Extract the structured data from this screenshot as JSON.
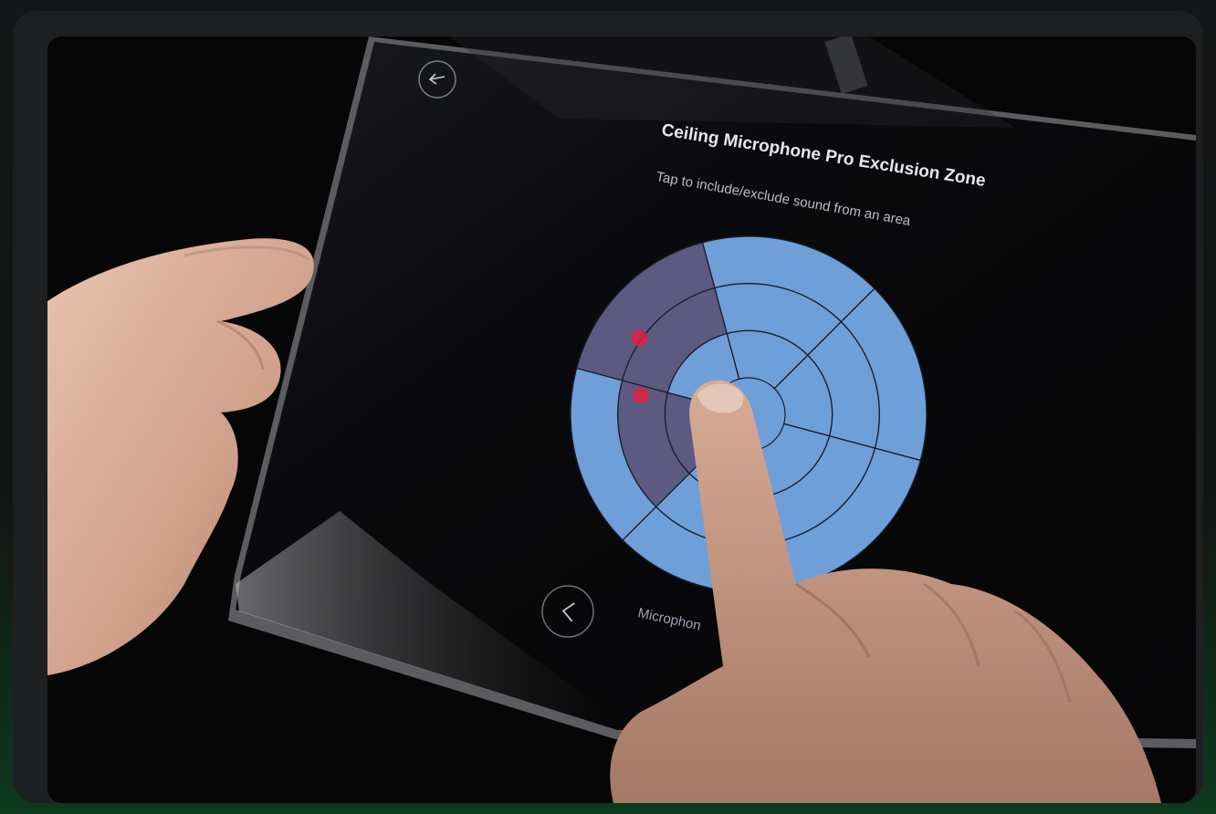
{
  "screen": {
    "title": "Ceiling Microphone Pro Exclusion Zone",
    "subtitle": "Tap to include/exclude sound from an area",
    "footer_text": "Microphon"
  },
  "zone_map": {
    "rings": 3,
    "sectors": 6,
    "excluded_color": "#5c5a80",
    "included_color": "#6f9fd9",
    "line_color": "#1a1f2e",
    "marker_color": "#e0213f"
  },
  "icons": {
    "back": "arrow-left-icon",
    "prev": "chevron-left-icon"
  }
}
